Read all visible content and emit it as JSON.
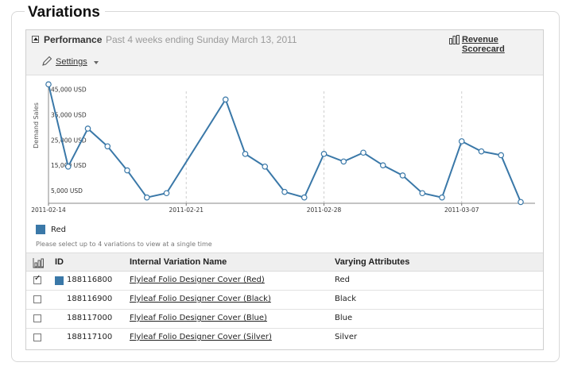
{
  "section": {
    "title": "Variations"
  },
  "performance": {
    "title": "Performance",
    "subtitle": "Past 4 weeks ending Sunday March 13, 2011",
    "scorecard_link": "Revenue Scorecard",
    "settings_label": "Settings"
  },
  "chart_data": {
    "type": "line",
    "ylabel": "Demand Sales",
    "y_ticks": [
      "45,000 USD",
      "35,000 USD",
      "25,000 USD",
      "15,000 USD",
      "5,000 USD"
    ],
    "y_tick_values": [
      45000,
      35000,
      25000,
      15000,
      5000
    ],
    "ylim": [
      0,
      48000
    ],
    "x_ticks": [
      "2011-02-14",
      "2011-02-21",
      "2011-02-28",
      "2011-03-07"
    ],
    "x": [
      "2011-02-14",
      "2011-02-15",
      "2011-02-16",
      "2011-02-17",
      "2011-02-18",
      "2011-02-19",
      "2011-02-20",
      "2011-02-21",
      "2011-02-22",
      "2011-02-23",
      "2011-02-24",
      "2011-02-25",
      "2011-02-26",
      "2011-02-27",
      "2011-02-28",
      "2011-03-01",
      "2011-03-02",
      "2011-03-03",
      "2011-03-04",
      "2011-03-05",
      "2011-03-06",
      "2011-03-07",
      "2011-03-08",
      "2011-03-09",
      "2011-03-10"
    ],
    "series": [
      {
        "name": "Red",
        "color": "#3a78a8",
        "values": [
          47000,
          14500,
          29500,
          22500,
          13000,
          2300,
          4000,
          null,
          null,
          41000,
          19500,
          14500,
          4500,
          2300,
          19500,
          16500,
          20000,
          15000,
          11000,
          4000,
          2300,
          24500,
          20500,
          19000,
          500
        ]
      }
    ],
    "legend": "bottom-left",
    "grid": false
  },
  "legend": {
    "label": "Red"
  },
  "hint": "Please select up to 4 variations to view at a single time",
  "table": {
    "headers": {
      "id": "ID",
      "name": "Internal Variation Name",
      "attrs": "Varying Attributes"
    },
    "rows": [
      {
        "checked": true,
        "id": "188116800",
        "name": "Flyleaf Folio Designer Cover (Red)",
        "attr": "Red"
      },
      {
        "checked": false,
        "id": "188116900",
        "name": "Flyleaf Folio Designer Cover (Black)",
        "attr": "Black"
      },
      {
        "checked": false,
        "id": "188117000",
        "name": "Flyleaf Folio Designer Cover (Blue)",
        "attr": "Blue"
      },
      {
        "checked": false,
        "id": "188117100",
        "name": "Flyleaf Folio Designer Cover (Silver)",
        "attr": "Silver"
      }
    ]
  }
}
